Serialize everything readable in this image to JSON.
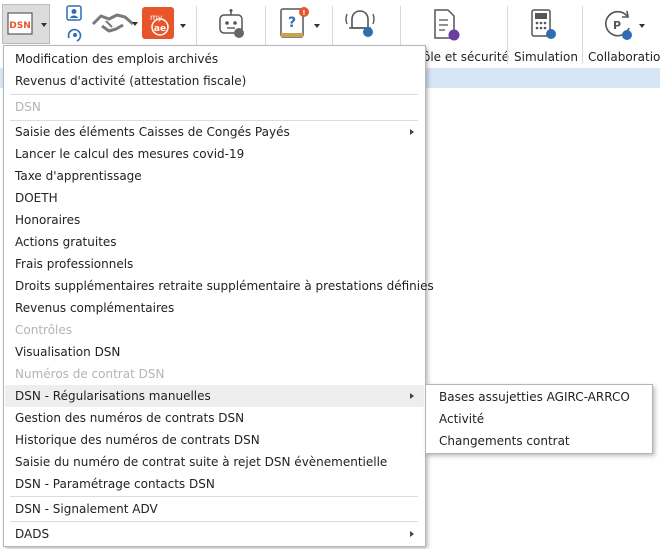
{
  "ribbon": {
    "buttons": [
      {
        "name": "dsn-icon"
      },
      {
        "name": "contact-card-icon"
      },
      {
        "name": "handshake-icon"
      },
      {
        "name": "myae-icon"
      },
      {
        "name": "robot-icon"
      },
      {
        "name": "help-book-icon"
      },
      {
        "name": "alarm-bell-icon"
      }
    ],
    "labels": {
      "role_security": "ôle et sécurité",
      "simulation": "Simulation",
      "collaboration": "Collaboration"
    },
    "colors": {
      "accent_orange": "#e8552b",
      "strip_blue": "#d7e6f5"
    }
  },
  "menu": {
    "items": [
      {
        "label": "Modification des emplois archivés"
      },
      {
        "label": "Revenus d'activité (attestation fiscale)"
      },
      {
        "label": "DSN"
      },
      {
        "label": "Saisie des éléments Caisses de Congés Payés"
      },
      {
        "label": "Lancer le calcul des mesures covid-19"
      },
      {
        "label": "Taxe d'apprentissage"
      },
      {
        "label": "DOETH"
      },
      {
        "label": "Honoraires"
      },
      {
        "label": "Actions gratuites"
      },
      {
        "label": "Frais professionnels"
      },
      {
        "label": "Droits supplémentaires retraite supplémentaire à prestations définies"
      },
      {
        "label": "Revenus complémentaires"
      },
      {
        "label": "Contrôles"
      },
      {
        "label": "Visualisation DSN"
      },
      {
        "label": "Numéros de contrat DSN"
      },
      {
        "label": "DSN - Régularisations manuelles"
      },
      {
        "label": "Gestion des numéros de contrats DSN"
      },
      {
        "label": "Historique des numéros de contrats DSN"
      },
      {
        "label": "Saisie du numéro de contrat suite à rejet DSN évènementielle"
      },
      {
        "label": "DSN - Paramétrage contacts DSN"
      },
      {
        "label": "DSN - Signalement ADV"
      },
      {
        "label": "DADS"
      }
    ]
  },
  "submenu": {
    "items": [
      {
        "label": "Bases assujetties AGIRC-ARRCO"
      },
      {
        "label": "Activité"
      },
      {
        "label": "Changements contrat"
      }
    ]
  }
}
